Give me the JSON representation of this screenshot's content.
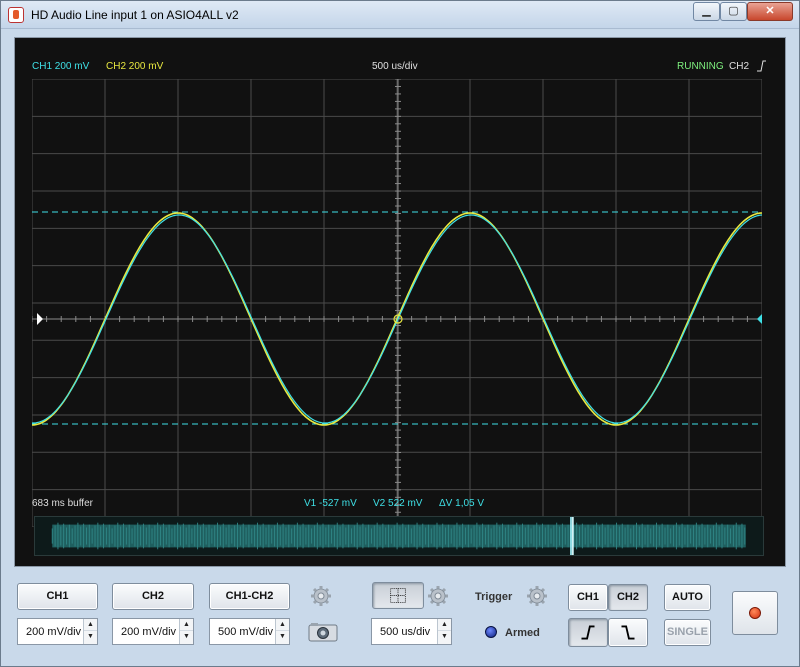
{
  "window": {
    "title": "HD Audio Line input 1 on ASIO4ALL v2"
  },
  "scope": {
    "ch1_label": "CH1 200 mV",
    "ch2_label": "CH2 200 mV",
    "timebase": "500 us/div",
    "status": "RUNNING",
    "trigger_source": "CH2",
    "buffer": "683 ms buffer",
    "v1": "V1 -527 mV",
    "v2": "V2 522 mV",
    "dv": "ΔV 1,05 V"
  },
  "colors": {
    "ch1": "#3fe0e6",
    "ch2": "#e8e840",
    "running": "#7ef07e",
    "grid": "#4a4a4a"
  },
  "controls": {
    "ch1": "CH1",
    "ch2": "CH2",
    "ch1_ch2": "CH1-CH2",
    "ch1_scale": "200 mV/div",
    "ch2_scale": "200 mV/div",
    "math_scale": "500 mV/div",
    "timebase_scale": "500 us/div",
    "trigger_label": "Trigger",
    "trigger_ch1": "CH1",
    "trigger_ch2": "CH2",
    "armed": "Armed",
    "auto": "AUTO",
    "single": "SINGLE"
  },
  "icons": {
    "settings": "gear-icon",
    "camera": "camera-icon",
    "grid": "grid-icon",
    "rising": "rising-edge-icon",
    "falling": "falling-edge-icon",
    "record": "record-icon"
  }
}
